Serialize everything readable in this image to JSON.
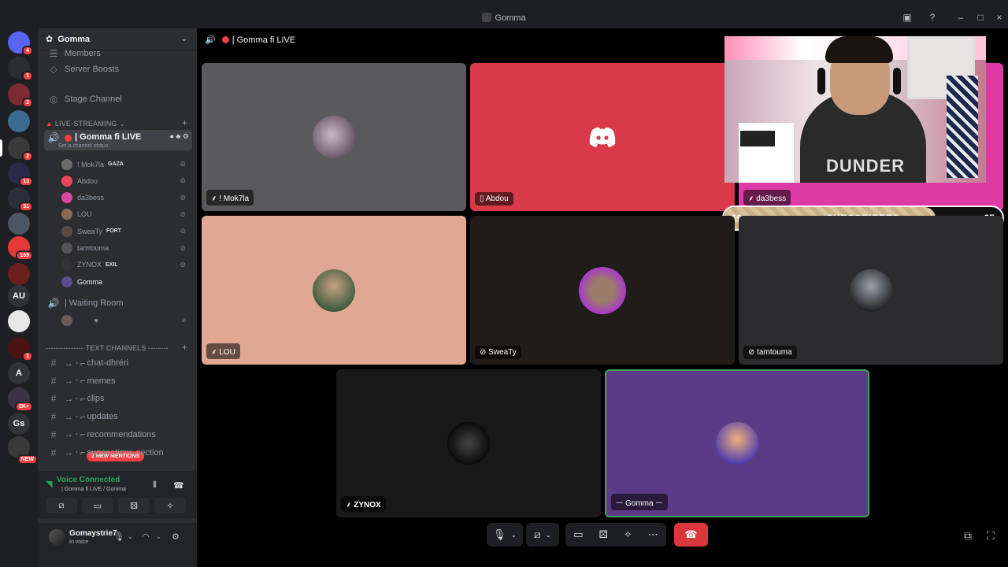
{
  "window": {
    "title": "Gomma"
  },
  "rail": {
    "servers": [
      {
        "label": "",
        "badge": "4",
        "color": "#5865f2"
      },
      {
        "label": "",
        "badge": "1",
        "color": "#2b2d31"
      },
      {
        "label": "",
        "badge": "2",
        "color": "#7a2b35"
      },
      {
        "label": "",
        "badge": "",
        "color": "#3b6b8f"
      },
      {
        "label": "",
        "badge": "2",
        "color": "#3a3a3a"
      },
      {
        "label": "",
        "badge": "13",
        "color": "#2a2a4a"
      },
      {
        "label": "",
        "badge": "31",
        "color": "#2a2f3a"
      },
      {
        "label": "",
        "badge": "",
        "color": "#4b5563"
      },
      {
        "label": "",
        "badge": "169",
        "color": "#e33939"
      },
      {
        "label": "",
        "badge": "",
        "color": "#6b1f1f"
      },
      {
        "label": "AU",
        "badge": "",
        "color": "#313338"
      },
      {
        "label": "",
        "badge": "",
        "color": "#e7e7e7"
      },
      {
        "label": "",
        "badge": "1",
        "color": "#4a1212"
      },
      {
        "label": "A",
        "badge": "",
        "color": "#313338"
      },
      {
        "label": "",
        "badge": "2K+",
        "color": "#3a3346"
      },
      {
        "label": "Gs",
        "badge": "",
        "color": "#313338"
      },
      {
        "label": "",
        "badge": "NEW",
        "color": "#3a3a3a"
      }
    ]
  },
  "sidebar": {
    "server_name": "Gomma",
    "members_label": "Members",
    "boosts_label": "Server Boosts",
    "stage_label": "Stage Channel",
    "category_live": "LIVE-STREAMING",
    "active_channel": {
      "name": "| Gomma fi LIVE",
      "status": "Set a channel status"
    },
    "voice_users": [
      {
        "name": "! Mok7la",
        "tag": "GAZA",
        "color": "#6b6b6b"
      },
      {
        "name": "Abdou",
        "tag": "",
        "color": "#e5485b"
      },
      {
        "name": "da3bess",
        "tag": "",
        "color": "#d9479f"
      },
      {
        "name": "LOU",
        "tag": "",
        "color": "#8b6a52"
      },
      {
        "name": "SweaTy",
        "tag": "FORT",
        "color": "#5a4a42"
      },
      {
        "name": "tamtouma",
        "tag": "",
        "color": "#555"
      },
      {
        "name": "ZYNOX",
        "tag": "EXIL",
        "color": "#333"
      },
      {
        "name": "Gomma",
        "tag": "",
        "color": "#5b4b8a"
      }
    ],
    "waiting_room": "| Waiting Room",
    "waiting_user": "ᅠ ᅠ ♥",
    "text_category": "Text Channels",
    "text_channels": [
      "chat-dhréri",
      "memes",
      "clips",
      "updates",
      "recommendations",
      "suggestions-section"
    ],
    "mentions_pill": "2 NEW MENTIONS"
  },
  "voice_panel": {
    "status": "Voice Connected",
    "channel": "| Gomma fi LIVE / Gomma"
  },
  "user": {
    "name": "Gomaystrie7",
    "status": "In voice"
  },
  "stage": {
    "header": "| Gomma fi LIVE",
    "tiles": [
      {
        "name": "! Mok7la"
      },
      {
        "name": "Abdou"
      },
      {
        "name": "da3bess"
      },
      {
        "name": "LOU"
      },
      {
        "name": "SweaTy"
      },
      {
        "name": "tamtouma"
      },
      {
        "name": "ZYNOX"
      },
      {
        "name": "Gomma"
      }
    ]
  },
  "overlay": {
    "sub_label": "SUBSCRIBERS",
    "sub_current": "19",
    "sub_goal": "25",
    "sub_progress": 0.76,
    "shirt_text": "DUNDER"
  },
  "colors": {
    "accent": "#5865f2",
    "danger": "#da373c",
    "connected": "#23a55a"
  }
}
